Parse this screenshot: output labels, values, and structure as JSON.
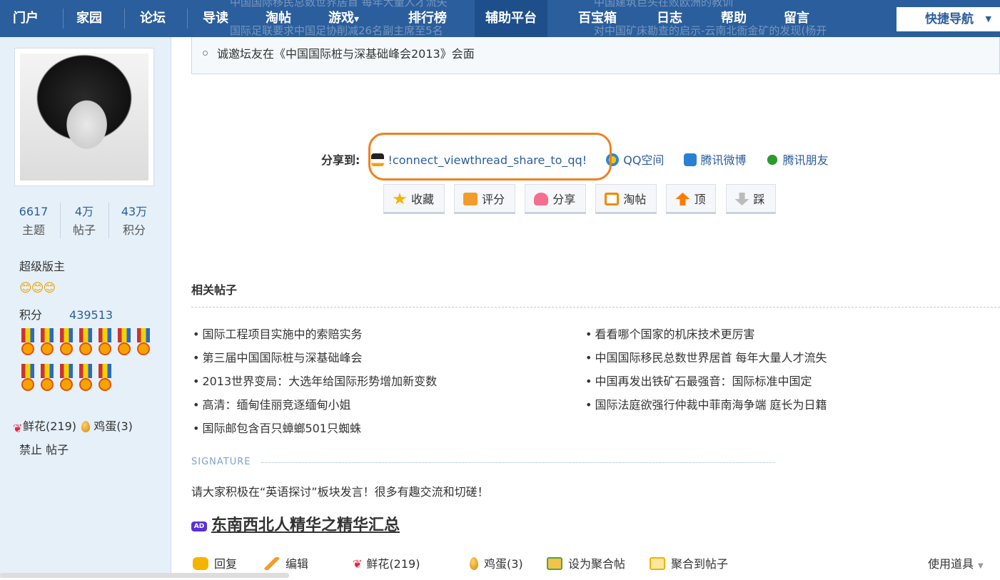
{
  "nav": {
    "items": [
      "门户",
      "家园",
      "论坛",
      "导读",
      "淘帖",
      "游戏",
      "排行榜",
      "辅助平台",
      "百宝箱",
      "日志",
      "帮助",
      "留言"
    ],
    "game_caret": "▾",
    "quick_nav": "快捷导航",
    "quick_caret": "▼"
  },
  "ghost_text": [
    "中国国际移民总数世界居首 每年大量人才流失",
    "国际足联要求中国足协削减26名副主席至5名",
    "中国建筑巨头在败欧洲的教训",
    "对中国矿床勘查的启示-云南北衙金矿的发现(杨开"
  ],
  "profile": {
    "stats": [
      {
        "value": "6617",
        "label": "主题"
      },
      {
        "value": "4万",
        "label": "帖子"
      },
      {
        "value": "43万",
        "label": "积分"
      }
    ],
    "role": "超级版主",
    "stars": "😊😊😊",
    "points_label": "积分",
    "points_value": "439513",
    "medal_count": 12,
    "gifts": {
      "flower": "鲜花(219)",
      "egg": "鸡蛋(3)"
    },
    "ban_label": "禁止 帖子"
  },
  "notice": "诚邀坛友在《中国国际桩与深基础峰会2013》会面",
  "share": {
    "label": "分享到:",
    "qq": "!connect_viewthread_share_to_qq!",
    "qzone": "QQ空间",
    "weibo": "腾讯微博",
    "pengyou": "腾讯朋友"
  },
  "actions": [
    "收藏",
    "评分",
    "分享",
    "淘帖",
    "顶",
    "踩"
  ],
  "related": {
    "title": "相关帖子",
    "left": [
      "国际工程项目实施中的索赔实务",
      "第三届中国国际桩与深基础峰会",
      "2013世界变局：大选年给国际形势增加新变数",
      "高清：缅甸佳丽竞逐缅甸小姐",
      "国际邮包含百只蟑螂501只蜘蛛"
    ],
    "right": [
      "看看哪个国家的机床技术更厉害",
      "中国国际移民总数世界居首 每年大量人才流失",
      "中国再发出铁矿石最强音：国际标准中国定",
      "国际法庭欲强行仲裁中菲南海争端 庭长为日籍"
    ]
  },
  "signature": {
    "label": "SIGNATURE",
    "text": "请大家积极在“英语探讨”板块发言！很多有趣交流和切磋！"
  },
  "ad": {
    "tag": "AD",
    "text": "东南西北人精华之精华汇总"
  },
  "bottom": {
    "reply": "回复",
    "edit": "编辑",
    "flower": "鲜花(219)",
    "egg": "鸡蛋(3)",
    "set_aggregate": "设为聚合帖",
    "aggregate_to": "聚合到帖子",
    "tools": "使用道具",
    "tools_caret": "▼"
  }
}
